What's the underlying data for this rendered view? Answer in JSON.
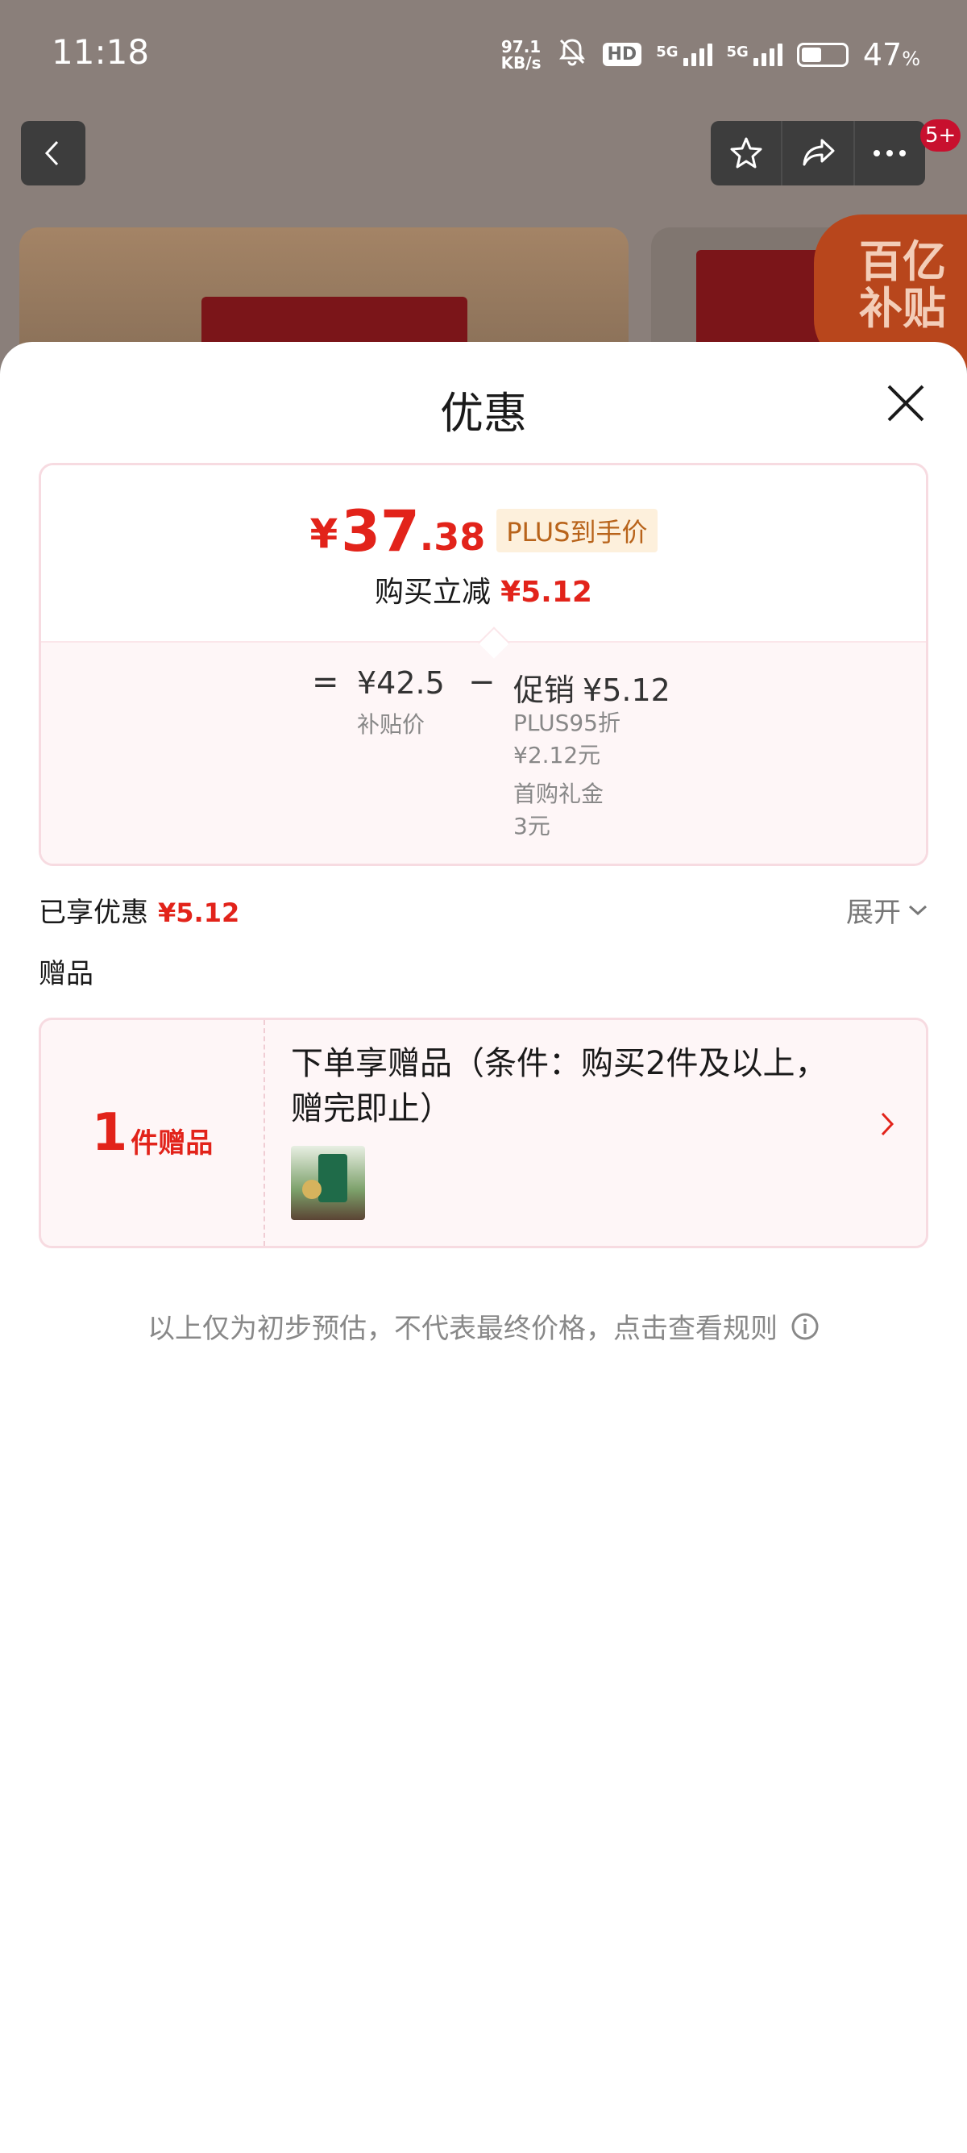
{
  "status_bar": {
    "time": "11:18",
    "net_speed_value": "97.1",
    "net_speed_unit": "KB/s",
    "hd_label": "HD",
    "signal1_label": "5G",
    "signal2_label": "5G",
    "battery_percent": "47",
    "battery_unit": "%",
    "battery_level": 0.47
  },
  "background_page": {
    "cart_badge": "5+",
    "subsidy_badge_line1": "百亿",
    "subsidy_badge_line2": "补贴",
    "colors": {
      "tin": "#7b1519",
      "badge": "#b8461c"
    }
  },
  "sheet": {
    "title": "优惠",
    "price": {
      "currency": "¥",
      "integer": "37",
      "decimal": ".38",
      "plus_tag": "PLUS到手价",
      "instant_label": "购买立减",
      "instant_amount": "¥5.12"
    },
    "breakdown": {
      "equals": "=",
      "subsidy_price": "¥42.5",
      "subsidy_label": "补贴价",
      "minus": "−",
      "promo_label": "促销",
      "promo_amount": "¥5.12",
      "promo_items": [
        "PLUS95折",
        "¥2.12元",
        "首购礼金",
        "3元"
      ]
    },
    "enjoyed": {
      "label": "已享优惠",
      "amount": "¥5.12",
      "expand_label": "展开"
    },
    "gifts": {
      "title": "赠品",
      "count": "1",
      "count_unit": "件赠品",
      "description": "下单享赠品（条件：购买2件及以上，赠完即止）"
    },
    "disclaimer": "以上仅为初步预估，不代表最终价格，点击查看规则"
  },
  "colors": {
    "accent_red": "#e2231a",
    "plus_tag_bg": "#fdf0dc",
    "plus_tag_text": "#b8631a",
    "card_border": "#f7dbe1",
    "card_bg": "#fef6f7"
  }
}
